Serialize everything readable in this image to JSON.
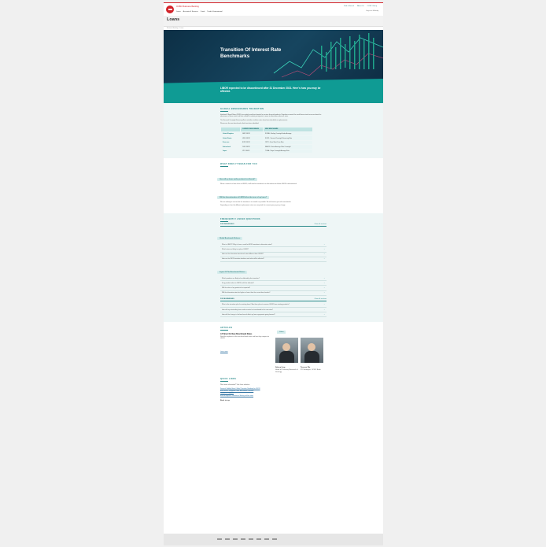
{
  "header": {
    "brand": "OCBC Business Banking",
    "nav": [
      "Loans",
      "Accounts & Services",
      "Cards",
      "Trade & International"
    ],
    "top_links": [
      "Find a Branch",
      "About Us",
      "OCBC Group"
    ],
    "account": "Log in to Velocity"
  },
  "title": "Loans",
  "breadcrumb": "Business Banking > Loans",
  "hero": {
    "title": "Transition Of Interest Rate Benchmarks",
    "banner": "LIBOR expected to be discontinued after 31 December 2021. Here's how you may be affected."
  },
  "global": {
    "heading": "GLOBAL BENCHMARKS TRANSITION",
    "p1": "Interbank Offered Rates (IBORs) are widely used benchmarks for various financial products. Regulators around the world have raised concerns about the robustness of these rates and have called for market participants to move to alternative reference rates.",
    "p2": "The Secured Overnight Financing Rate and other risk-free rates have been identified as replacements.",
    "p3": "Please see the new benchmarks that have been identified:",
    "table": {
      "headers": [
        "",
        "CURRENT BENCHMARK",
        "NEW BENCHMARK"
      ],
      "rows": [
        [
          "United Kingdom",
          "GBP LIBOR",
          "SONIA - Sterling Overnight Index Average"
        ],
        [
          "United States",
          "USD LIBOR",
          "SOFR - Secured Overnight Financing Rate"
        ],
        [
          "Euro area",
          "EUR LIBOR",
          "€STR - Euro Short-Term Rate"
        ],
        [
          "Switzerland",
          "CHF LIBOR",
          "SARON - Swiss Average Rate Overnight"
        ],
        [
          "Japan",
          "JPY LIBOR",
          "TONA - Tokyo Overnight Average Rate"
        ]
      ]
    }
  },
  "mean": {
    "heading": "WHAT DOES IT MEAN FOR YOU",
    "q1": "How will my loans and/or products be affected?",
    "p1": "When a contract or loan refers to LIBOR, it will need to transition to an alternative rate before LIBOR is discontinued.",
    "q2": "Will the discontinuation of LIBOR affect the terms of my loans?",
    "p2": "We are working to ensure that the transition is as smooth as possible. We will contact you with more details.",
    "p3": "Depending on how the different replacement rates are computed, the amount you pay may change."
  },
  "faq": {
    "heading": "FREQUENTLY ASKED QUESTIONS",
    "individuals": "FOR INDIVIDUALS",
    "close_all": "Close all sections",
    "groups": [
      {
        "title": "Global Benchmark Reforms",
        "items": [
          "What is LIBOR? Why is there a need for IBOR transition to alternative rates?",
          "Which rates are likely to replace LIBOR?",
          "How are the alternative benchmark rates different from LIBOR?",
          "How are the IBOR transition timelines and what will be affected?"
        ]
      },
      {
        "title": "Impact Of The Benchmark Reform",
        "items": [
          "Which products are likely to be affected by the transition?",
          "If my product refers to LIBOR, will it be affected?",
          "Will the value of my products be impacted?",
          "Will the alternative rates be higher or lower than the current benchmarks?"
        ]
      }
    ],
    "business": "FOR BUSINESSES",
    "business_items": [
      "What is the transition plan for existing loans? Are there plans to remove LIBOR from existing products?",
      "How will my outstanding loans and accounts be transitioned to the new rates?",
      "How will the change in the benchmark affect my loan repayments going forward?"
    ]
  },
  "articles": {
    "heading": "ARTICLES",
    "card_title": "A Primer On New Benchmark Rates",
    "card_text": "Read the explainer on the new benchmark rates and how they compare to LIBOR.",
    "read_more": "Learn more",
    "videos": "Videos",
    "people": [
      {
        "name": "Selena Ling",
        "role": "Head of Treasury Research & Strategy"
      },
      {
        "name": "Terence Wu",
        "role": "FX Strategist, OCBC Bank"
      }
    ]
  },
  "quick": {
    "heading": "QUICK LINKS",
    "intro": "Want more information? Visit these websites:",
    "links": [
      "Financial Stability Board: Global Transition Roadmap for LIBOR",
      "ABS-SFEMC Singapore Dollar Benchmark Transition",
      "ISDA IBOR Fallbacks",
      "Bank of England: Transition to Sterling risk-free rates"
    ]
  },
  "footer": {
    "back": "Back to top"
  }
}
